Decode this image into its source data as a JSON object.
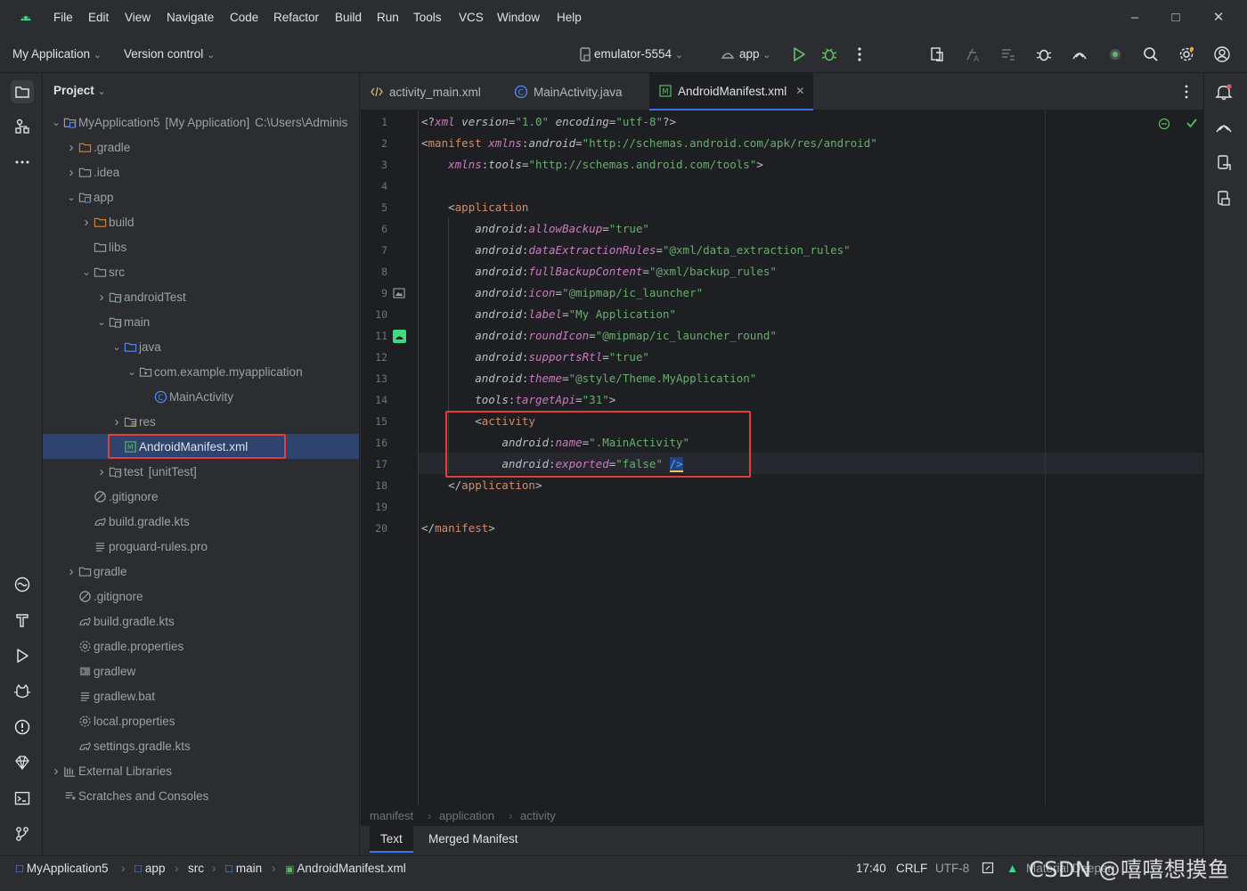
{
  "menu": {
    "items": [
      "File",
      "Edit",
      "View",
      "Navigate",
      "Code",
      "Refactor",
      "Build",
      "Run",
      "Tools",
      "VCS",
      "Window",
      "Help"
    ]
  },
  "toolbar": {
    "project_name": "My Application",
    "version_control": "Version control",
    "device": "emulator-5554",
    "run_config": "app"
  },
  "project_panel": {
    "title": "Project",
    "tree": [
      {
        "label": "MyApplication5",
        "extra": "[My Application]",
        "path": "C:\\Users\\Adminis",
        "icon": "module-folder-icon",
        "chev": "v",
        "indent": 0
      },
      {
        "label": ".gradle",
        "icon": "folder-orange-icon",
        "chev": ">",
        "indent": 1
      },
      {
        "label": ".idea",
        "icon": "folder-icon",
        "chev": ">",
        "indent": 1
      },
      {
        "label": "app",
        "icon": "module-folder-icon",
        "chev": "v",
        "indent": 1
      },
      {
        "label": "build",
        "icon": "folder-orange-icon",
        "chev": ">",
        "indent": 2
      },
      {
        "label": "libs",
        "icon": "folder-icon",
        "chev": "",
        "indent": 2
      },
      {
        "label": "src",
        "icon": "folder-icon",
        "chev": "v",
        "indent": 2
      },
      {
        "label": "androidTest",
        "icon": "test-folder-icon",
        "chev": ">",
        "indent": 3
      },
      {
        "label": "main",
        "icon": "source-folder-icon",
        "chev": "v",
        "indent": 3
      },
      {
        "label": "java",
        "icon": "source-root-icon",
        "chev": "v",
        "indent": 4
      },
      {
        "label": "com.example.myapplication",
        "icon": "package-icon",
        "chev": "v",
        "indent": 5
      },
      {
        "label": "MainActivity",
        "icon": "class-icon",
        "chev": "",
        "indent": 6
      },
      {
        "label": "res",
        "icon": "resource-folder-icon",
        "chev": ">",
        "indent": 4
      },
      {
        "label": "AndroidManifest.xml",
        "icon": "manifest-icon",
        "chev": "",
        "indent": 4,
        "selected": true
      },
      {
        "label": "test",
        "extra": "[unitTest]",
        "icon": "test-folder-icon",
        "chev": ">",
        "indent": 3
      },
      {
        "label": ".gitignore",
        "icon": "ignore-icon",
        "chev": "",
        "indent": 2
      },
      {
        "label": "build.gradle.kts",
        "icon": "gradle-icon",
        "chev": "",
        "indent": 2
      },
      {
        "label": "proguard-rules.pro",
        "icon": "text-file-icon",
        "chev": "",
        "indent": 2
      },
      {
        "label": "gradle",
        "icon": "folder-icon",
        "chev": ">",
        "indent": 1
      },
      {
        "label": ".gitignore",
        "icon": "ignore-icon",
        "chev": "",
        "indent": 1
      },
      {
        "label": "build.gradle.kts",
        "icon": "gradle-icon",
        "chev": "",
        "indent": 1
      },
      {
        "label": "gradle.properties",
        "icon": "settings-file-icon",
        "chev": "",
        "indent": 1
      },
      {
        "label": "gradlew",
        "icon": "script-icon",
        "chev": "",
        "indent": 1
      },
      {
        "label": "gradlew.bat",
        "icon": "text-file-icon",
        "chev": "",
        "indent": 1
      },
      {
        "label": "local.properties",
        "icon": "settings-file-icon",
        "chev": "",
        "indent": 1
      },
      {
        "label": "settings.gradle.kts",
        "icon": "gradle-icon",
        "chev": "",
        "indent": 1
      },
      {
        "label": "External Libraries",
        "icon": "library-icon",
        "chev": ">",
        "indent": 0
      },
      {
        "label": "Scratches and Consoles",
        "icon": "scratches-icon",
        "chev": "",
        "indent": 0
      }
    ]
  },
  "editor_tabs": [
    {
      "label": "activity_main.xml",
      "icon": "layout-xml-icon",
      "active": false
    },
    {
      "label": "MainActivity.java",
      "icon": "class-icon",
      "active": false
    },
    {
      "label": "AndroidManifest.xml",
      "icon": "manifest-icon",
      "active": true
    }
  ],
  "editor": {
    "line_numbers": [
      "1",
      "2",
      "3",
      "4",
      "5",
      "6",
      "7",
      "8",
      "9",
      "10",
      "11",
      "12",
      "13",
      "14",
      "15",
      "16",
      "17",
      "18",
      "19",
      "20"
    ],
    "lines": [
      [
        [
          "t-punct",
          "<?"
        ],
        [
          "t-purple",
          "xml "
        ],
        [
          "t-attrname",
          "version"
        ],
        [
          "t-punct",
          "="
        ],
        [
          "t-str",
          "\"1.0\""
        ],
        [
          "t-punct",
          " "
        ],
        [
          "t-attrname",
          "encoding"
        ],
        [
          "t-punct",
          "="
        ],
        [
          "t-str",
          "\"utf-8\""
        ],
        [
          "t-punct",
          "?>"
        ]
      ],
      [
        [
          "t-punct",
          "<"
        ],
        [
          "t-tag2",
          "manifest "
        ],
        [
          "t-ns",
          "xmlns"
        ],
        [
          "t-punct",
          ":"
        ],
        [
          "t-attrname",
          "android"
        ],
        [
          "t-punct",
          "="
        ],
        [
          "t-str",
          "\"http://schemas.android.com/apk/res/android\""
        ]
      ],
      [
        [
          "t-punct",
          "    "
        ],
        [
          "t-ns",
          "xmlns"
        ],
        [
          "t-punct",
          ":"
        ],
        [
          "t-attrname",
          "tools"
        ],
        [
          "t-punct",
          "="
        ],
        [
          "t-str",
          "\"http://schemas.android.com/tools\""
        ],
        [
          "t-punct",
          ">"
        ]
      ],
      [],
      [
        [
          "t-punct",
          "    <"
        ],
        [
          "t-tag2",
          "application"
        ]
      ],
      [
        [
          "t-punct",
          "        "
        ],
        [
          "t-attrname",
          "android"
        ],
        [
          "t-punct",
          ":"
        ],
        [
          "t-ns",
          "allowBackup"
        ],
        [
          "t-punct",
          "="
        ],
        [
          "t-str",
          "\"true\""
        ]
      ],
      [
        [
          "t-punct",
          "        "
        ],
        [
          "t-attrname",
          "android"
        ],
        [
          "t-punct",
          ":"
        ],
        [
          "t-ns",
          "dataExtractionRules"
        ],
        [
          "t-punct",
          "="
        ],
        [
          "t-str",
          "\"@xml/data_extraction_rules\""
        ]
      ],
      [
        [
          "t-punct",
          "        "
        ],
        [
          "t-attrname",
          "android"
        ],
        [
          "t-punct",
          ":"
        ],
        [
          "t-ns",
          "fullBackupContent"
        ],
        [
          "t-punct",
          "="
        ],
        [
          "t-str",
          "\"@xml/backup_rules\""
        ]
      ],
      [
        [
          "t-punct",
          "        "
        ],
        [
          "t-attrname",
          "android"
        ],
        [
          "t-punct",
          ":"
        ],
        [
          "t-ns",
          "icon"
        ],
        [
          "t-punct",
          "="
        ],
        [
          "t-str",
          "\"@mipmap/ic_launcher\""
        ]
      ],
      [
        [
          "t-punct",
          "        "
        ],
        [
          "t-attrname",
          "android"
        ],
        [
          "t-punct",
          ":"
        ],
        [
          "t-ns",
          "label"
        ],
        [
          "t-punct",
          "="
        ],
        [
          "t-str",
          "\"My Application\""
        ]
      ],
      [
        [
          "t-punct",
          "        "
        ],
        [
          "t-attrname",
          "android"
        ],
        [
          "t-punct",
          ":"
        ],
        [
          "t-ns",
          "roundIcon"
        ],
        [
          "t-punct",
          "="
        ],
        [
          "t-str",
          "\"@mipmap/ic_launcher_round\""
        ]
      ],
      [
        [
          "t-punct",
          "        "
        ],
        [
          "t-attrname",
          "android"
        ],
        [
          "t-punct",
          ":"
        ],
        [
          "t-ns",
          "supportsRtl"
        ],
        [
          "t-punct",
          "="
        ],
        [
          "t-str",
          "\"true\""
        ]
      ],
      [
        [
          "t-punct",
          "        "
        ],
        [
          "t-attrname",
          "android"
        ],
        [
          "t-punct",
          ":"
        ],
        [
          "t-ns",
          "theme"
        ],
        [
          "t-punct",
          "="
        ],
        [
          "t-str",
          "\"@style/Theme.MyApplication\""
        ]
      ],
      [
        [
          "t-punct",
          "        "
        ],
        [
          "t-attrname",
          "tools"
        ],
        [
          "t-punct",
          ":"
        ],
        [
          "t-ns",
          "targetApi"
        ],
        [
          "t-punct",
          "="
        ],
        [
          "t-str",
          "\"31\""
        ],
        [
          "t-punct",
          ">"
        ]
      ],
      [
        [
          "t-punct",
          "        <"
        ],
        [
          "t-tag2",
          "activity"
        ]
      ],
      [
        [
          "t-punct",
          "            "
        ],
        [
          "t-attrname",
          "android"
        ],
        [
          "t-punct",
          ":"
        ],
        [
          "t-ns",
          "name"
        ],
        [
          "t-punct",
          "="
        ],
        [
          "t-str",
          "\".MainActivity\""
        ]
      ],
      [
        [
          "t-punct",
          "            "
        ],
        [
          "t-attrname",
          "android"
        ],
        [
          "t-punct",
          ":"
        ],
        [
          "t-ns",
          "exported"
        ],
        [
          "t-punct",
          "="
        ],
        [
          "t-str",
          "\"false\""
        ],
        [
          "t-punct",
          " "
        ],
        [
          "t-blue",
          "/>"
        ]
      ],
      [
        [
          "t-punct",
          "    </"
        ],
        [
          "t-tag2",
          "application"
        ],
        [
          "t-punct",
          ">"
        ]
      ],
      [],
      [
        [
          "t-punct",
          "</"
        ],
        [
          "t-tag2",
          "manifest"
        ],
        [
          "t-punct",
          ">"
        ]
      ]
    ]
  },
  "breadcrumb": [
    "manifest",
    "application",
    "activity"
  ],
  "bottom_tabs": {
    "text": "Text",
    "merged": "Merged Manifest"
  },
  "statusbar": {
    "path": [
      "MyApplication5",
      "app",
      "src",
      "main",
      "AndroidManifest.xml"
    ],
    "position": "17:40",
    "line_sep": "CRLF",
    "encoding": "UTF-8",
    "theme": "Material Deeper"
  },
  "watermark": "CSDN @嘻嘻想摸鱼",
  "colors": {
    "accent": "#3574f0",
    "highlight_box": "#e0403b",
    "run_green": "#5fb865"
  }
}
